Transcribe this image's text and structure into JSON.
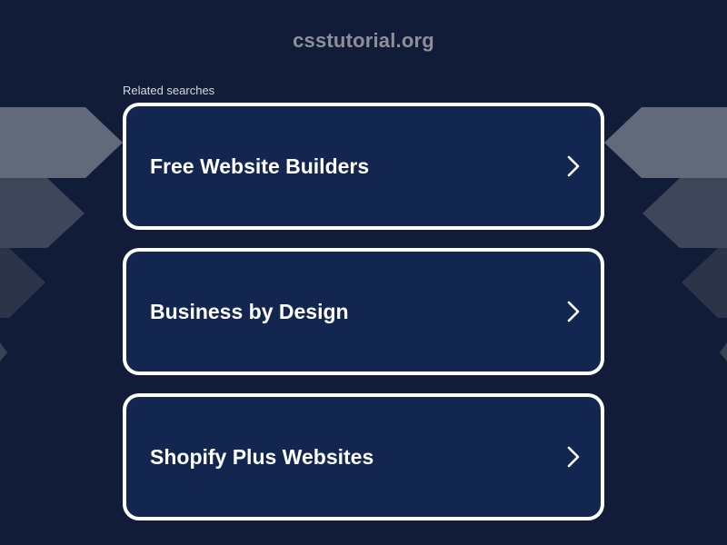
{
  "header": {
    "site_title": "csstutorial.org"
  },
  "related": {
    "label": "Related searches",
    "items": [
      {
        "label": "Free Website Builders",
        "icon": "chevron-right-icon"
      },
      {
        "label": "Business by Design",
        "icon": "chevron-right-icon"
      },
      {
        "label": "Shopify Plus Websites",
        "icon": "chevron-right-icon"
      }
    ]
  },
  "colors": {
    "background": "#111d38",
    "card_background": "#12264f",
    "card_border": "#ffffff",
    "title_text": "#8e9098"
  }
}
